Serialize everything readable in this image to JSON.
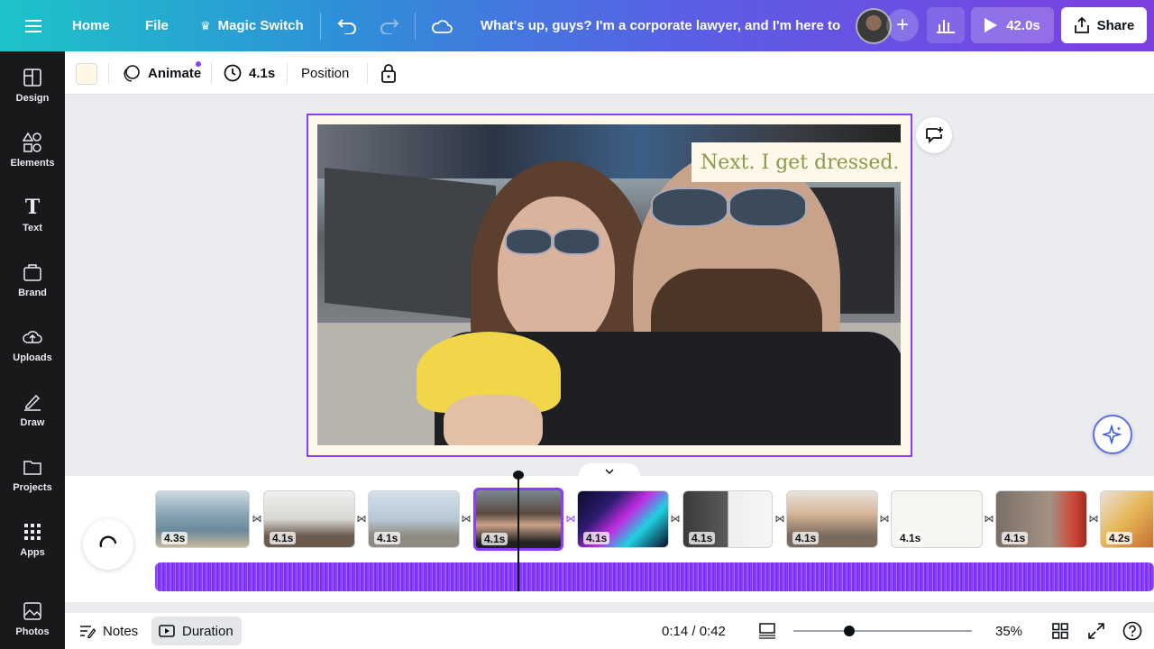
{
  "topbar": {
    "home_label": "Home",
    "file_label": "File",
    "magic_switch_label": "Magic Switch",
    "doc_title": "What's up, guys? I'm a corporate lawyer, and I'm here to ...",
    "play_duration": "42.0s",
    "share_label": "Share",
    "menu_icon": "hamburger-icon",
    "undo_icon": "undo-icon",
    "redo_icon": "redo-icon",
    "cloud_icon": "cloud-sync-icon"
  },
  "sidebar": {
    "items": [
      {
        "label": "Design",
        "icon": "design-icon"
      },
      {
        "label": "Elements",
        "icon": "elements-icon"
      },
      {
        "label": "Text",
        "icon": "text-icon"
      },
      {
        "label": "Brand",
        "icon": "brand-icon"
      },
      {
        "label": "Uploads",
        "icon": "uploads-icon"
      },
      {
        "label": "Draw",
        "icon": "draw-icon"
      },
      {
        "label": "Projects",
        "icon": "projects-icon"
      },
      {
        "label": "Apps",
        "icon": "apps-icon"
      },
      {
        "label": "Photos",
        "icon": "photos-icon"
      }
    ]
  },
  "toolbar": {
    "animate_label": "Animate",
    "duration_label": "4.1s",
    "position_label": "Position",
    "swatch_color": "#fff7e8"
  },
  "canvas": {
    "caption_text": "Next. I get dressed.",
    "caption_color": "#8b9a4a"
  },
  "timeline": {
    "scenes": [
      {
        "duration": "4.3s"
      },
      {
        "duration": "4.1s"
      },
      {
        "duration": "4.1s"
      },
      {
        "duration": "4.1s"
      },
      {
        "duration": "4.1s"
      },
      {
        "duration": "4.1s"
      },
      {
        "duration": "4.1s"
      },
      {
        "duration": "4.1s"
      },
      {
        "duration": "4.1s"
      },
      {
        "duration": "4.2s"
      }
    ],
    "active_index": 3
  },
  "bottombar": {
    "notes_label": "Notes",
    "duration_label": "Duration",
    "time_display": "0:14 / 0:42",
    "zoom_label": "35%"
  },
  "colors": {
    "accent": "#8b3dff",
    "sidebar_bg": "#18191b"
  }
}
